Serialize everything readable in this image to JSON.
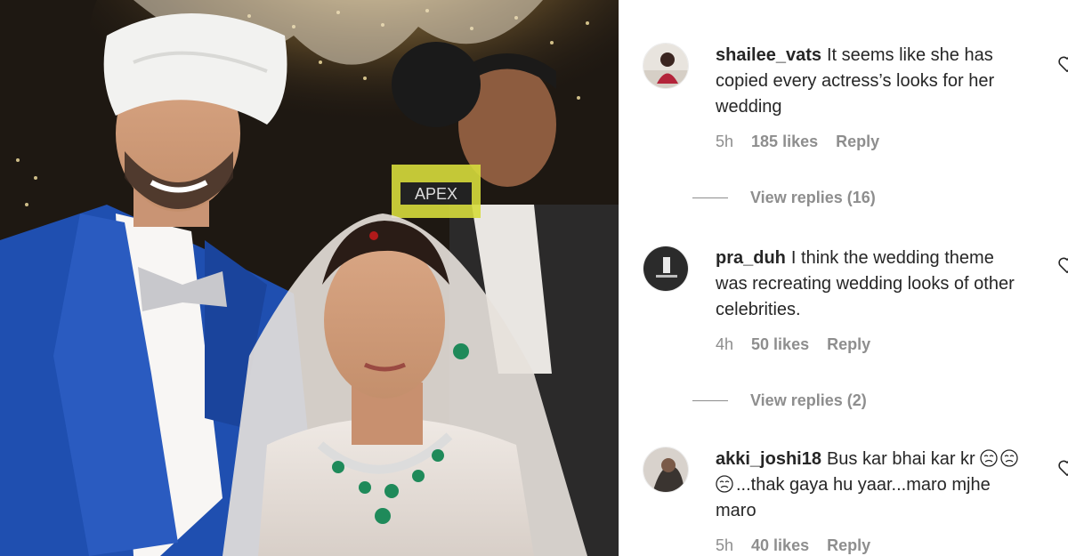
{
  "photo": {
    "subject": "wedding-couple-photo",
    "vest_text": "APEX"
  },
  "comments": [
    {
      "username": "shailee_vats",
      "text": "It seems like she has copied every actress’s looks for her wedding",
      "time": "5h",
      "likes": "185 likes",
      "reply_label": "Reply",
      "view_replies": "View replies (16)"
    },
    {
      "username": "pra_duh",
      "text": "I think the wedding theme was recreating wedding looks of other celebrities.",
      "time": "4h",
      "likes": "50 likes",
      "reply_label": "Reply",
      "view_replies": "View replies (2)"
    },
    {
      "username": "akki_joshi18",
      "text_pre": "Bus kar bhai kar kr",
      "text_post": "...thak gaya hu yaar...maro mjhe maro",
      "emoji": "crying-face-emoji",
      "time": "5h",
      "likes": "40 likes",
      "reply_label": "Reply"
    }
  ],
  "colors": {
    "text": "#262626",
    "secondary": "#8e8e8e",
    "blazer": "#1f4fb0",
    "turban": "#f2f2f0"
  }
}
